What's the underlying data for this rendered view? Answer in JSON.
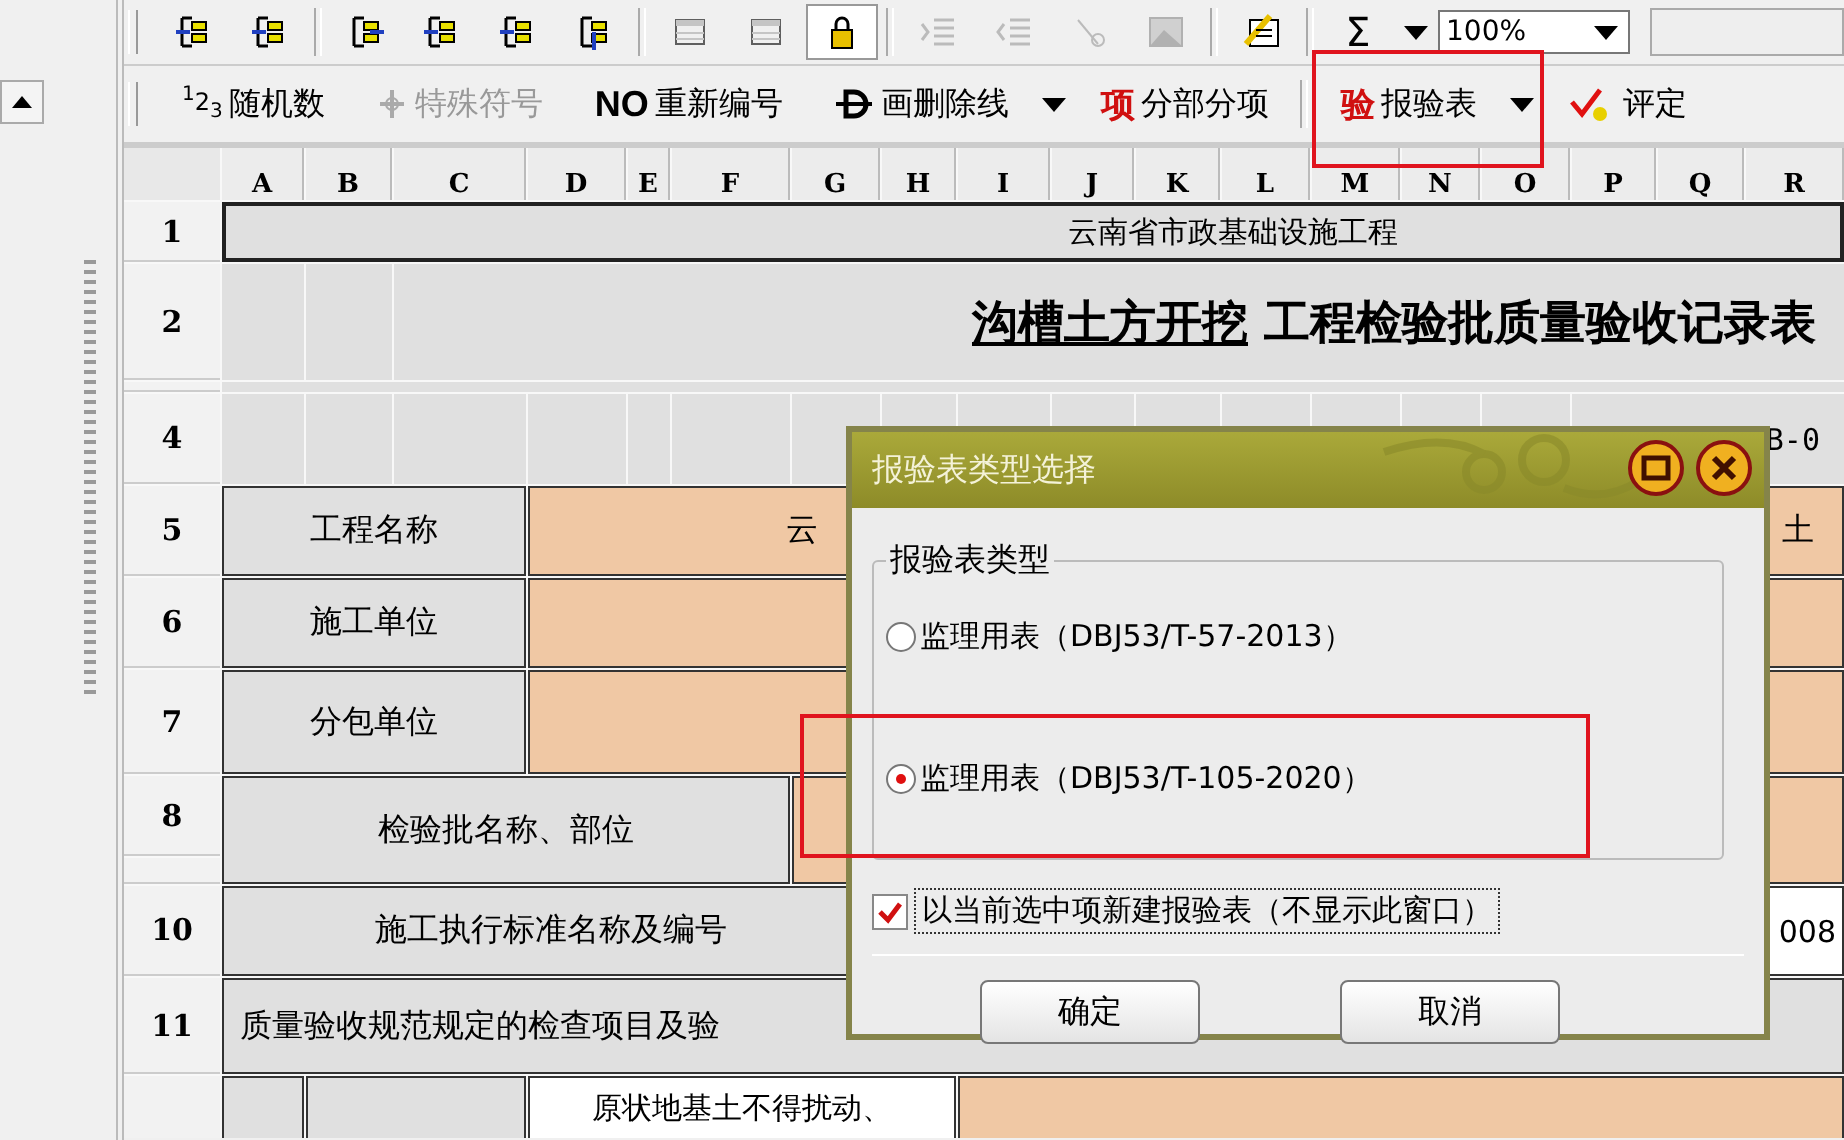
{
  "toolbar_top": {
    "tools": [
      {
        "kind": "row-left",
        "disabled": false,
        "selected": false
      },
      {
        "kind": "row-header",
        "disabled": false,
        "selected": false
      },
      {
        "kind": "row-right",
        "disabled": false,
        "selected": false
      },
      {
        "kind": "split",
        "disabled": false,
        "selected": false
      },
      {
        "kind": "col-left",
        "disabled": false,
        "selected": false
      },
      {
        "kind": "col-down",
        "disabled": false,
        "selected": false
      },
      {
        "kind": "grid",
        "disabled": true,
        "selected": false
      },
      {
        "kind": "grid",
        "disabled": true,
        "selected": false
      },
      {
        "kind": "lock",
        "disabled": false,
        "selected": true
      },
      {
        "kind": "indent",
        "disabled": true,
        "selected": false
      },
      {
        "kind": "outdent",
        "disabled": true,
        "selected": false
      },
      {
        "kind": "wand",
        "disabled": true,
        "selected": false
      },
      {
        "kind": "picture",
        "disabled": true,
        "selected": false
      },
      {
        "kind": "formula",
        "disabled": false,
        "selected": false
      }
    ],
    "sum_glyph": "Σ",
    "zoom_value": "100%"
  },
  "toolbar_bottom": [
    {
      "kind": "numbers",
      "glyph": "$^{1}$2$_{3}$",
      "label": "随机数",
      "disabled": false,
      "dropdown": false
    },
    {
      "kind": "symbol",
      "label": "特殊符号",
      "disabled": true,
      "dropdown": false
    },
    {
      "kind": "renumber",
      "glyph": "NO",
      "label": "重新编号",
      "disabled": false,
      "dropdown": false
    },
    {
      "kind": "strike",
      "label": "画删除线",
      "disabled": false,
      "dropdown": true
    },
    {
      "kind": "red-glyph",
      "glyph": "项",
      "label": "分部分项",
      "disabled": false,
      "dropdown": false
    },
    {
      "kind": "red-glyph",
      "glyph": "验",
      "label": "报验表",
      "disabled": false,
      "dropdown": true
    },
    {
      "kind": "tick",
      "label": "评定",
      "disabled": false,
      "dropdown": false
    }
  ],
  "sheet": {
    "columns": [
      "A",
      "B",
      "C",
      "D",
      "E",
      "F",
      "G",
      "H",
      "I",
      "J",
      "K",
      "L",
      "M",
      "N",
      "O",
      "P",
      "Q",
      "R"
    ],
    "row_numbers": [
      "1",
      "2",
      "4",
      "5",
      "6",
      "7",
      "8",
      "10",
      "11"
    ],
    "project_group": "云南省市政基础设施工程",
    "title_subject": "沟槽土方开挖",
    "title": "工程检验批质量验收记录表",
    "form_code": "B-0",
    "fields": [
      {
        "label": "工程名称",
        "value_start": "云",
        "value_end": "土"
      },
      {
        "label": "施工单位"
      },
      {
        "label": "分包单位"
      },
      {
        "label": "检验批名称、部位"
      }
    ],
    "standard": {
      "label": "施工执行标准名称及编号",
      "value_end": "008"
    },
    "inspection_header": "质量验收规范规定的检查项目及验",
    "item_text": "原状地基土不得扰动、"
  },
  "dialog": {
    "title": "报验表类型选择",
    "group_label": "报验表类型",
    "options": [
      {
        "label": "监理用表（DBJ53/T-57-2013）",
        "selected": false
      },
      {
        "label": "监理用表（DBJ53/T-105-2020）",
        "selected": true
      }
    ],
    "checkbox": {
      "label": "以当前选中项新建报验表（不显示此窗口）",
      "checked": true
    },
    "buttons": [
      "确定",
      "取消"
    ]
  }
}
